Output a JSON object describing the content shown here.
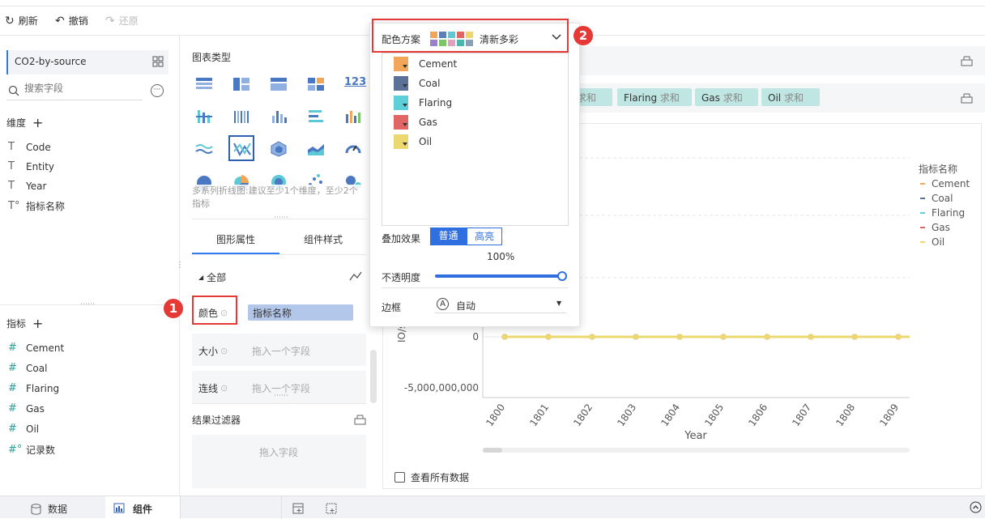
{
  "toolbar": {
    "refresh": "刷新",
    "undo": "撤销",
    "redo": "还原"
  },
  "left": {
    "dataset": "CO2-by-source",
    "search_placeholder": "搜索字段",
    "dimension_title": "维度",
    "dimensions": [
      "Code",
      "Entity",
      "Year",
      "指标名称"
    ],
    "measure_title": "指标",
    "measures": [
      "Cement",
      "Coal",
      "Flaring",
      "Gas",
      "Oil",
      "记录数"
    ]
  },
  "middle": {
    "chart_type_title": "图表类型",
    "chart_hint": "多系列折线图:建议至少1个维度，至少2个指标",
    "tab_props": "图形属性",
    "tab_style": "组件样式",
    "all_label": "全部",
    "color_label": "颜色",
    "color_field": "指标名称",
    "size_label": "大小",
    "size_placeholder": "拖入一个字段",
    "line_label": "连线",
    "line_placeholder": "拖入一个字段",
    "filter_title": "结果过滤器",
    "filter_placeholder": "拖入字段"
  },
  "shelf": {
    "pills": [
      {
        "field": "",
        "agg": "求和"
      },
      {
        "field": "Flaring",
        "agg": "求和"
      },
      {
        "field": "Gas",
        "agg": "求和"
      },
      {
        "field": "Oil",
        "agg": "求和"
      }
    ]
  },
  "popup": {
    "scheme_label": "配色方案",
    "scheme_name": "清新多彩",
    "scheme_colors": [
      "#f2a65a",
      "#5b7fb5",
      "#5cc9d4",
      "#e06666",
      "#f0d56a",
      "#9b7fc8",
      "#7cc36a",
      "#e0a0c0",
      "#4db6ac",
      "#8aa0b8"
    ],
    "items": [
      {
        "name": "Cement",
        "color": "#f2a65a"
      },
      {
        "name": "Coal",
        "color": "#5b7296"
      },
      {
        "name": "Flaring",
        "color": "#5ccfd8"
      },
      {
        "name": "Gas",
        "color": "#e06666"
      },
      {
        "name": "Oil",
        "color": "#ecd870"
      }
    ],
    "overlay_label": "叠加效果",
    "overlay_normal": "普通",
    "overlay_bright": "高亮",
    "opacity_value": "100%",
    "opacity_label": "不透明度",
    "border_label": "边框",
    "border_value": "自动",
    "border_icon": "A"
  },
  "badges": {
    "one": "1",
    "two": "2"
  },
  "chart": {
    "view_all": "查看所有数据"
  },
  "chart_data": {
    "type": "line",
    "x": [
      1800,
      1801,
      1802,
      1803,
      1804,
      1805,
      1806,
      1807,
      1808,
      1809
    ],
    "xlabel": "Year",
    "ylabel_fragment": "IO/s",
    "yticks_visible": [
      "0",
      "-5,000,000,000"
    ],
    "series": [
      {
        "name": "Cement",
        "color": "#f2a65a",
        "values": [
          0,
          0,
          0,
          0,
          0,
          0,
          0,
          0,
          0,
          0
        ]
      },
      {
        "name": "Coal",
        "color": "#5b7296",
        "values": [
          0,
          0,
          0,
          0,
          0,
          0,
          0,
          0,
          0,
          0
        ]
      },
      {
        "name": "Flaring",
        "color": "#5ccfd8",
        "values": [
          0,
          0,
          0,
          0,
          0,
          0,
          0,
          0,
          0,
          0
        ]
      },
      {
        "name": "Gas",
        "color": "#e06666",
        "values": [
          0,
          0,
          0,
          0,
          0,
          0,
          0,
          0,
          0,
          0
        ]
      },
      {
        "name": "Oil",
        "color": "#ecd870",
        "values": [
          0,
          0,
          0,
          0,
          0,
          0,
          0,
          0,
          0,
          0
        ]
      }
    ],
    "legend_title": "指标名称",
    "legend_position": "right"
  },
  "bottom": {
    "data_tab": "数据",
    "component_tab": "组件"
  }
}
